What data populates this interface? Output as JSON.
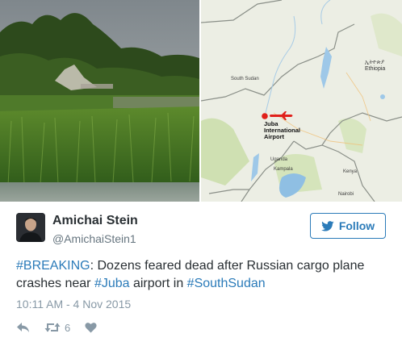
{
  "media": {
    "map_labels": {
      "south_sudan": "South Sudan",
      "ethiopia": "Ethiopia",
      "ethiopia_native": "ኢትዮጵያ",
      "juba_airport": "Juba International Airport",
      "uganda": "Uganda",
      "kampala": "Kampala",
      "kenya": "Kenya",
      "nairobi": "Nairobi"
    }
  },
  "tweet": {
    "author_name": "Amichai Stein",
    "author_handle": "@AmichaiStein1",
    "follow_label": "Follow",
    "text_parts": [
      {
        "text": "#BREAKING",
        "hashtag": true
      },
      {
        "text": ": Dozens feared dead after Russian cargo plane crashes near ",
        "hashtag": false
      },
      {
        "text": "#Juba",
        "hashtag": true
      },
      {
        "text": " airport in ",
        "hashtag": false
      },
      {
        "text": "#SouthSudan",
        "hashtag": true
      }
    ],
    "timestamp": "10:11 AM - 4 Nov 2015",
    "retweet_count": "6"
  },
  "icons": {
    "reply": "reply-icon",
    "retweet": "retweet-icon",
    "like": "heart-icon",
    "follow_bird": "twitter-bird-icon"
  },
  "colors": {
    "link": "#2b7bb9",
    "muted": "#8899a6",
    "text": "#292f33",
    "plane_marker": "#e0201b"
  }
}
